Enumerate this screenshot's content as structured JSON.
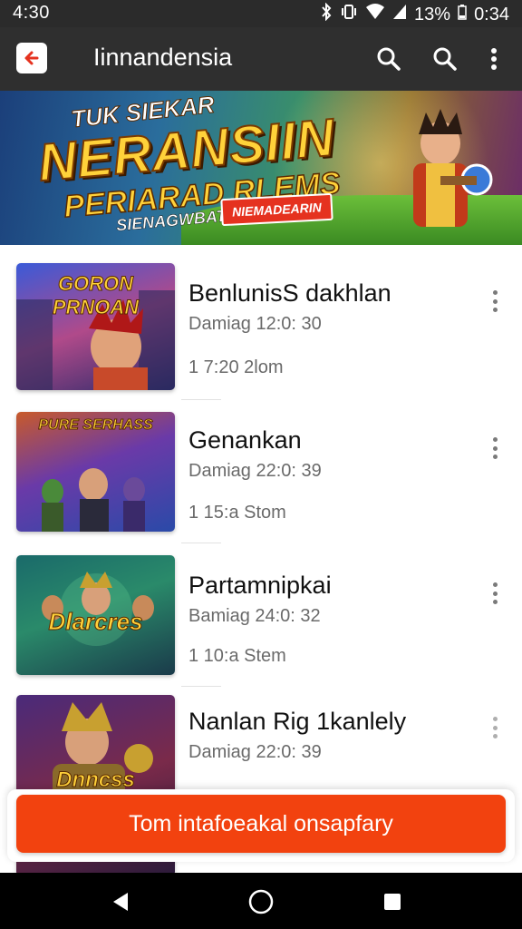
{
  "status_bar": {
    "time": "4:30",
    "battery": "13%",
    "clock": "0:34"
  },
  "app_bar": {
    "title": "Iinnandensia"
  },
  "banner": {
    "line1": "TUK SIEKAR",
    "line2": "NERANSIIN",
    "line3": "PERIARAD RLEMS",
    "line4": "SIENAGWBATUS",
    "badge": "NIEMADEARIN"
  },
  "items": [
    {
      "thumb_text": "GORON PRNOAN",
      "name": "BenlunisS dakhlan",
      "meta1": "Damiag 12:0: 30",
      "meta2": "1 7:20 2lom"
    },
    {
      "thumb_text": "PURE SERHASS",
      "name": "Genankan",
      "meta1": "Damiag 22:0: 39",
      "meta2": "1 15:a Stom"
    },
    {
      "thumb_text": "Dlarcres",
      "name": "Partamnipkai",
      "meta1": "Bamiag 24:0: 32",
      "meta2": "1 10:a Stem"
    },
    {
      "thumb_text": "Dnncss",
      "name": "Nanlan Rig 1kanlely",
      "meta1": "Damiag 22:0: 39",
      "meta2": ""
    }
  ],
  "cta": {
    "label": "Tom intafoeakal onsapfary"
  }
}
